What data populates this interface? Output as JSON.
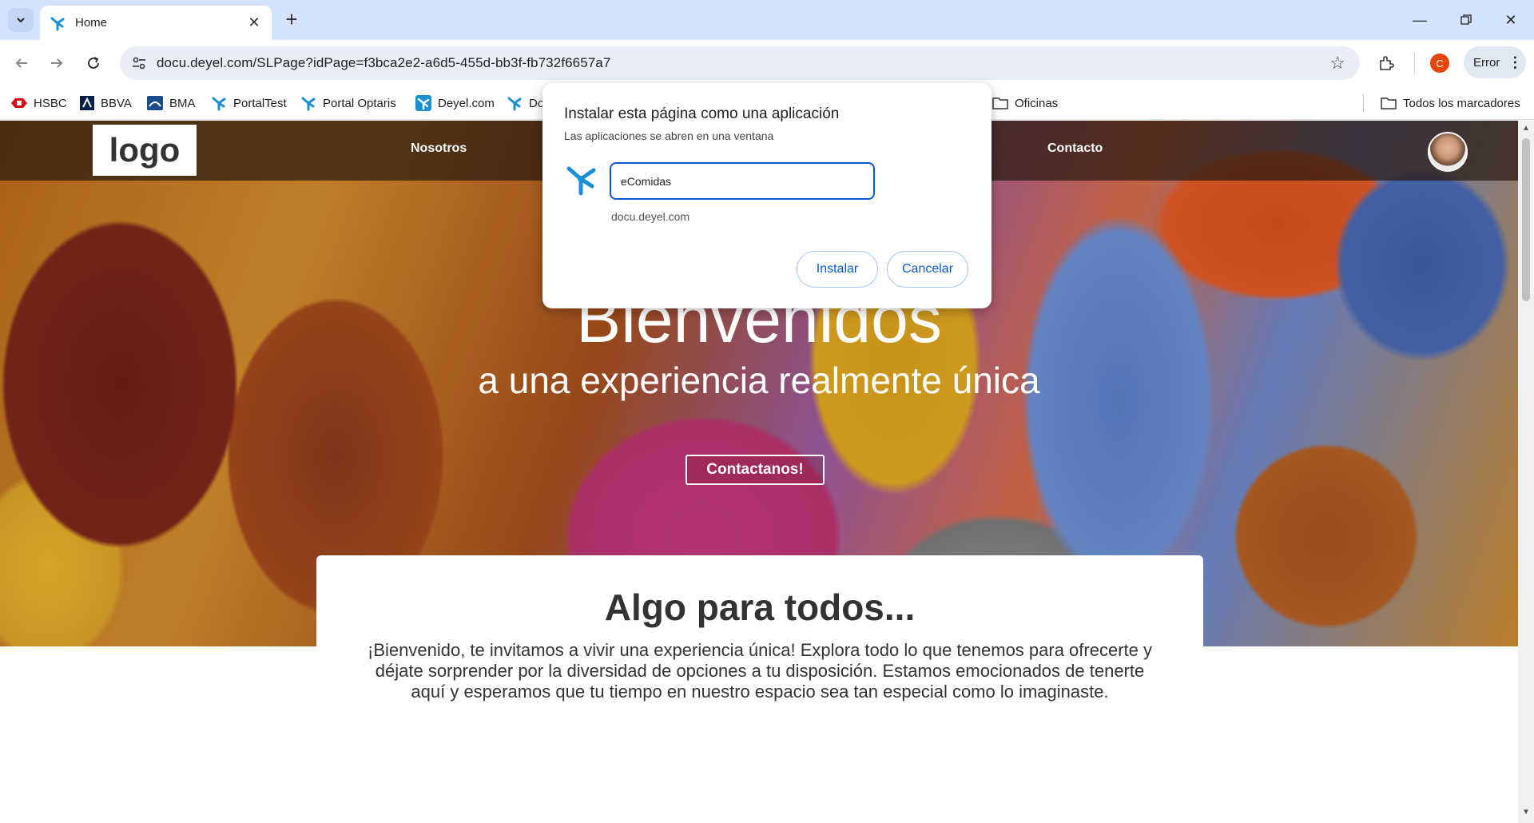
{
  "browser": {
    "tab_title": "Home",
    "url": "docu.deyel.com/SLPage?idPage=f3bca2e2-a6d5-455d-bb3f-fb732f6657a7",
    "profile_initial": "C",
    "error_label": "Error",
    "bookmarks": [
      "HSBC",
      "BBVA",
      "BMA",
      "PortalTest",
      "Portal Optaris",
      "Deyel.com",
      "Do",
      "Oficinas"
    ],
    "all_bookmarks_label": "Todos los marcadores"
  },
  "site": {
    "logo": "logo",
    "nav": [
      "Nosotros",
      "Contacto"
    ],
    "hero_title": "Bienvenidos",
    "hero_subtitle": "a una experiencia realmente única",
    "cta_label": "Contactanos!",
    "section_title": "Algo para todos...",
    "section_text": "¡Bienvenido, te invitamos a vivir una experiencia única! Explora todo lo que tenemos para ofrecerte y déjate sorprender por la diversidad de opciones a tu disposición. Estamos emocionados de tenerte aquí y esperamos que tu tiempo en nuestro espacio sea tan especial como lo imaginaste."
  },
  "dialog": {
    "title": "Instalar esta página como una aplicación",
    "subtitle": "Las aplicaciones se abren en una ventana",
    "app_name_value": "eComidas",
    "origin": "docu.deyel.com",
    "install_label": "Instalar",
    "cancel_label": "Cancelar"
  },
  "colors": {
    "accent": "#0b57d0",
    "tabstrip": "#d3e3fd",
    "deyel_blue": "#1a8fd6"
  }
}
